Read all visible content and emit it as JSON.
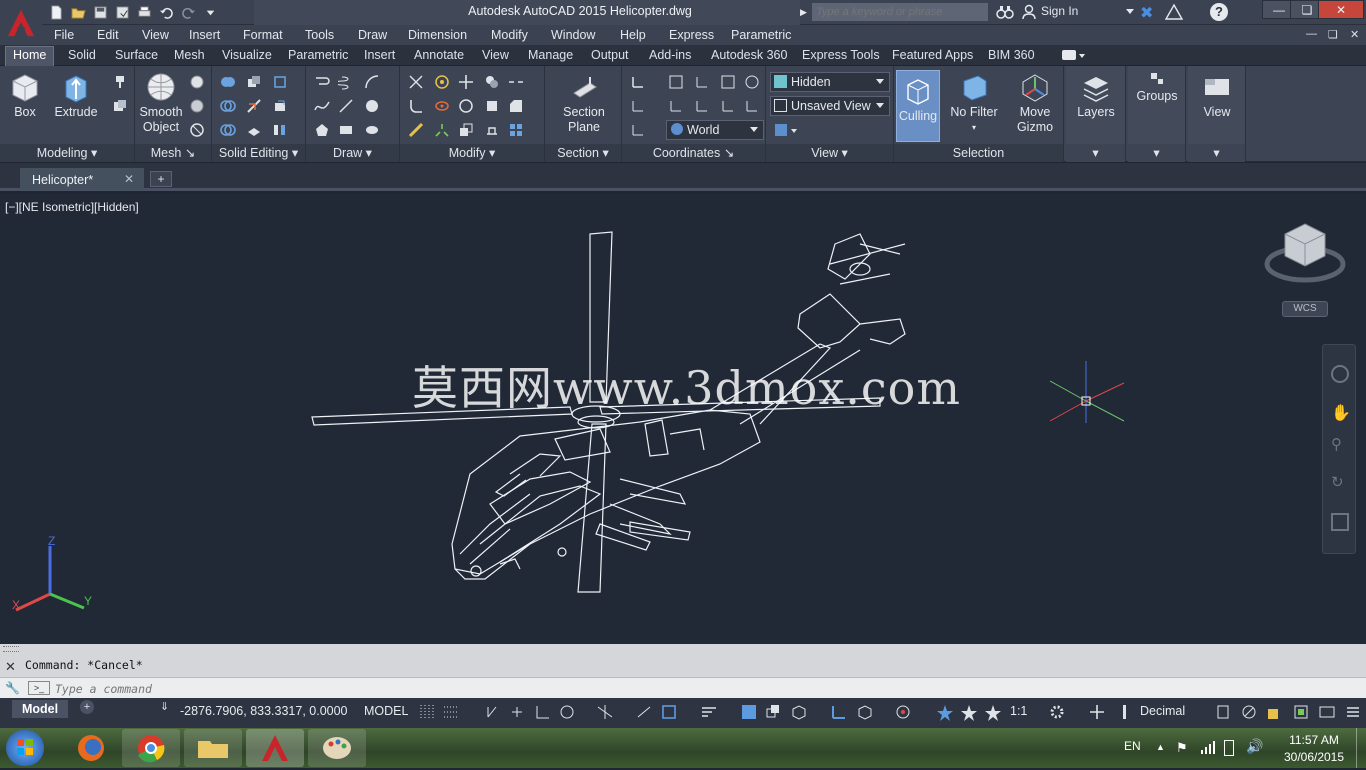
{
  "titlebar": {
    "title": "Autodesk AutoCAD 2015    Helicopter.dwg",
    "search_placeholder": "Type a keyword or phrase",
    "signin": "Sign In"
  },
  "menubar": {
    "items": [
      "File",
      "Edit",
      "View",
      "Insert",
      "Format",
      "Tools",
      "Draw",
      "Dimension",
      "Modify",
      "Window",
      "Help",
      "Express",
      "Parametric"
    ]
  },
  "ribbon_tabs": [
    "Home",
    "Solid",
    "Surface",
    "Mesh",
    "Visualize",
    "Parametric",
    "Insert",
    "Annotate",
    "View",
    "Manage",
    "Output",
    "Add-ins",
    "Autodesk 360",
    "Express Tools",
    "Featured Apps",
    "BIM 360"
  ],
  "panels": {
    "modeling": {
      "title": "Modeling",
      "box": "Box",
      "extrude": "Extrude"
    },
    "mesh": {
      "title": "Mesh",
      "smooth_line1": "Smooth",
      "smooth_line2": "Object"
    },
    "solid_editing": {
      "title": "Solid Editing"
    },
    "draw": {
      "title": "Draw"
    },
    "modify": {
      "title": "Modify"
    },
    "section": {
      "title": "Section",
      "section_line1": "Section",
      "section_line2": "Plane"
    },
    "coordinates": {
      "title": "Coordinates",
      "ucs": "World"
    },
    "view": {
      "title": "View",
      "visual_style": "Hidden",
      "named_view": "Unsaved View"
    },
    "selection": {
      "title": "Selection",
      "culling": "Culling",
      "no_filter": "No Filter",
      "gizmo_line1": "Move",
      "gizmo_line2": "Gizmo"
    },
    "layers": "Layers",
    "groups": "Groups",
    "view_btn": "View"
  },
  "document": {
    "tab": "Helicopter*",
    "new_tab": "+"
  },
  "viewport": {
    "label": "[−][NE Isometric][Hidden]",
    "watermark": "莫西网www.3dmox.com",
    "wcs": "WCS",
    "ucs_x": "X",
    "ucs_y": "Y",
    "ucs_z": "Z"
  },
  "command": {
    "history": "Command: *Cancel*",
    "placeholder": "Type a command"
  },
  "status": {
    "model_tab": "Model",
    "coords": "-2876.7906, 833.3317, 0.0000",
    "model_button": "MODEL",
    "scale": "1:1",
    "units": "Decimal"
  },
  "taskbar": {
    "lang": "EN",
    "time": "11:57 AM",
    "date": "30/06/2015"
  },
  "colors": {
    "accent": "#c8242b",
    "selected": "#6a8fc4"
  }
}
